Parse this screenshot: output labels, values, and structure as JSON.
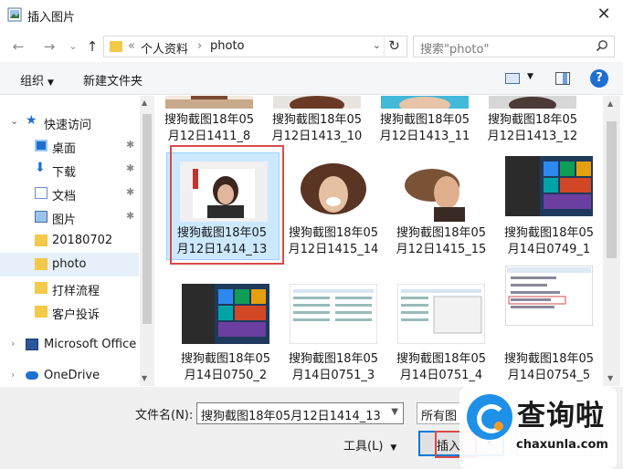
{
  "window": {
    "title": "插入图片",
    "close_glyph": "✕"
  },
  "nav": {
    "back_glyph": "←",
    "forward_glyph": "→",
    "recent_glyph": "⌄",
    "up_glyph": "↑",
    "breadcrumb": [
      "«",
      "个人资料",
      "›",
      "photo"
    ],
    "address_dropdown_glyph": "⌄",
    "refresh_glyph": "↻",
    "search_placeholder": "搜索\"photo\""
  },
  "commandbar": {
    "organize": "组织",
    "new_folder": "新建文件夹",
    "help": "?"
  },
  "sidebar": {
    "items": [
      {
        "label": "快速访问",
        "icon": "star-icon"
      },
      {
        "label": "桌面",
        "icon": "desktop-icon",
        "pinned": true
      },
      {
        "label": "下载",
        "icon": "downloads-icon",
        "pinned": true
      },
      {
        "label": "文档",
        "icon": "documents-icon",
        "pinned": true
      },
      {
        "label": "图片",
        "icon": "pictures-icon",
        "pinned": true
      },
      {
        "label": "20180702",
        "icon": "folder-icon"
      },
      {
        "label": "photo",
        "icon": "folder-icon",
        "selected": true
      },
      {
        "label": "打样流程",
        "icon": "folder-icon"
      },
      {
        "label": "客户投诉",
        "icon": "folder-icon"
      },
      {
        "label": "Microsoft Office",
        "icon": "office-icon"
      },
      {
        "label": "OneDrive",
        "icon": "cloud-icon"
      }
    ],
    "pin_glyph": "📌",
    "expand_glyph": "›"
  },
  "files": [
    {
      "line1": "搜狗截图18年05",
      "line2": "月12日1411_8",
      "thumb": "partial-top"
    },
    {
      "line1": "搜狗截图18年05",
      "line2": "月12日1413_10",
      "thumb": "partial-top"
    },
    {
      "line1": "搜狗截图18年05",
      "line2": "月12日1413_11",
      "thumb": "partial-top"
    },
    {
      "line1": "搜狗截图18年05",
      "line2": "月12日1413_12",
      "thumb": "partial-top"
    },
    {
      "line1": "搜狗截图18年05",
      "line2": "月12日1414_13",
      "thumb": "photo-woman",
      "selected": true
    },
    {
      "line1": "搜狗截图18年05",
      "line2": "月12日1415_14",
      "thumb": "photo-woman"
    },
    {
      "line1": "搜狗截图18年05",
      "line2": "月12日1415_15",
      "thumb": "photo-woman"
    },
    {
      "line1": "搜狗截图18年05",
      "line2": "月14日0749_1",
      "thumb": "screenshot-start"
    },
    {
      "line1": "搜狗截图18年05",
      "line2": "月14日0750_2",
      "thumb": "screenshot-start"
    },
    {
      "line1": "搜狗截图18年05",
      "line2": "月14日0751_3",
      "thumb": "screenshot-list"
    },
    {
      "line1": "搜狗截图18年05",
      "line2": "月14日0751_4",
      "thumb": "screenshot-list"
    },
    {
      "line1": "搜狗截图18年05",
      "line2": "月14日0754_5",
      "thumb": "screenshot-dialog"
    }
  ],
  "bottom": {
    "filename_label": "文件名(N):",
    "filename_value": "搜狗截图18年05月12日1414_13",
    "filetype_value": "所有图",
    "tools_label": "工具(L)",
    "insert_label": "插入(",
    "dropdown_glyph": "▾"
  },
  "watermark": {
    "title": "查询啦",
    "url": "chaxunla.com"
  },
  "colors": {
    "accent": "#0078d7",
    "selection": "#cce8ff",
    "highlight": "#d84a4a",
    "folder": "#f3c94a"
  }
}
